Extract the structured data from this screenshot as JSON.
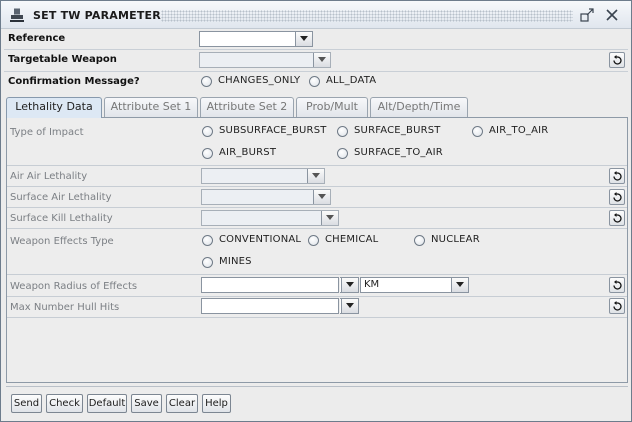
{
  "window": {
    "title": "SET TW PARAMETER",
    "icons": {
      "app": "stamp-icon",
      "restore": "restore-window-icon",
      "close": "close-window-icon"
    }
  },
  "top": {
    "reference": {
      "label": "Reference",
      "value": ""
    },
    "targetable_weapon": {
      "label": "Targetable Weapon",
      "value": ""
    },
    "confirmation": {
      "label": "Confirmation Message?",
      "options": [
        "CHANGES_ONLY",
        "ALL_DATA"
      ],
      "selected": null
    }
  },
  "tabs": [
    "Lethality Data",
    "Attribute Set 1",
    "Attribute Set 2",
    "Prob/Mult",
    "Alt/Depth/Time"
  ],
  "active_tab": "Lethality Data",
  "lethality": {
    "type_of_impact": {
      "label": "Type of Impact",
      "options": [
        "SUBSURFACE_BURST",
        "SURFACE_BURST",
        "AIR_TO_AIR",
        "AIR_BURST",
        "SURFACE_TO_AIR"
      ],
      "selected": null
    },
    "air_air_lethality": {
      "label": "Air Air Lethality",
      "value": ""
    },
    "surface_air_lethality": {
      "label": "Surface Air Lethality",
      "value": ""
    },
    "surface_kill_lethality": {
      "label": "Surface Kill Lethality",
      "value": ""
    },
    "weapon_effects_type": {
      "label": "Weapon Effects Type",
      "options": [
        "CONVENTIONAL",
        "CHEMICAL",
        "NUCLEAR",
        "MINES"
      ],
      "selected": null
    },
    "weapon_radius": {
      "label": "Weapon Radius of Effects",
      "value": "",
      "unit": "KM"
    },
    "max_hull_hits": {
      "label": "Max Number Hull Hits",
      "value": ""
    }
  },
  "buttons": [
    "Send",
    "Check",
    "Default",
    "Save",
    "Clear",
    "Help"
  ],
  "colors": {
    "active_tab": "#dde8f4",
    "panel": "#ededed",
    "label_dim": "#7b7f84"
  }
}
